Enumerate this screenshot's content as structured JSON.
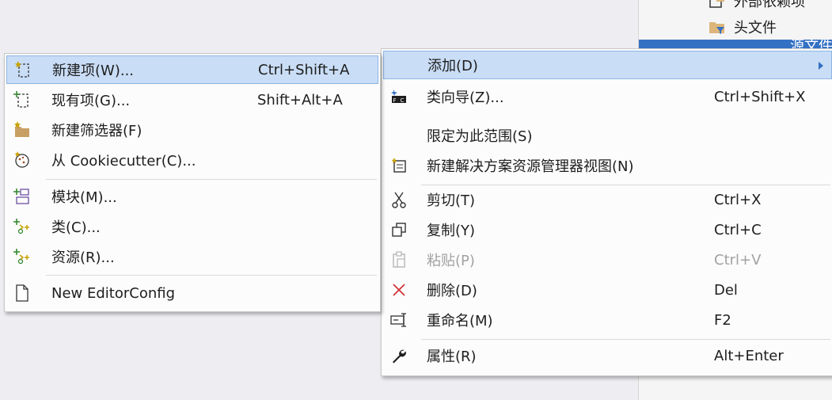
{
  "explorer": {
    "items": [
      {
        "label": "外部依赖项",
        "icon": "external-deps-icon"
      },
      {
        "label": "头文件",
        "icon": "header-files-folder-icon"
      },
      {
        "label": "源文件",
        "icon": "source-files-folder-icon"
      }
    ]
  },
  "context_menu": {
    "items": [
      {
        "label": "添加(D)",
        "shortcut": "",
        "icon": "",
        "submenu": true
      },
      {
        "label": "类向导(Z)...",
        "shortcut": "Ctrl+Shift+X",
        "icon": "class-wizard-icon"
      },
      {
        "label": "限定为此范围(S)",
        "shortcut": "",
        "icon": ""
      },
      {
        "label": "新建解决方案资源管理器视图(N)",
        "shortcut": "",
        "icon": "new-explorer-view-icon"
      },
      {
        "label": "剪切(T)",
        "shortcut": "Ctrl+X",
        "icon": "cut-icon"
      },
      {
        "label": "复制(Y)",
        "shortcut": "Ctrl+C",
        "icon": "copy-icon"
      },
      {
        "label": "粘贴(P)",
        "shortcut": "Ctrl+V",
        "icon": "paste-icon",
        "disabled": true
      },
      {
        "label": "删除(D)",
        "shortcut": "Del",
        "icon": "delete-icon"
      },
      {
        "label": "重命名(M)",
        "shortcut": "F2",
        "icon": "rename-icon"
      },
      {
        "label": "属性(R)",
        "shortcut": "Alt+Enter",
        "icon": "properties-wrench-icon"
      }
    ]
  },
  "add_submenu": {
    "items": [
      {
        "label": "新建项(W)...",
        "shortcut": "Ctrl+Shift+A",
        "icon": "new-item-icon"
      },
      {
        "label": "现有项(G)...",
        "shortcut": "Shift+Alt+A",
        "icon": "existing-item-icon"
      },
      {
        "label": "新建筛选器(F)",
        "shortcut": "",
        "icon": "new-filter-icon"
      },
      {
        "label": "从 Cookiecutter(C)...",
        "shortcut": "",
        "icon": "cookiecutter-icon"
      },
      {
        "label": "模块(M)...",
        "shortcut": "",
        "icon": "module-icon"
      },
      {
        "label": "类(C)...",
        "shortcut": "",
        "icon": "add-class-icon"
      },
      {
        "label": "资源(R)...",
        "shortcut": "",
        "icon": "add-resource-icon"
      },
      {
        "label": "New EditorConfig",
        "shortcut": "",
        "icon": "editorconfig-file-icon"
      }
    ]
  },
  "colors": {
    "highlight": "#c9ddf6",
    "accent": "#3470c4",
    "delete_red": "#d13438",
    "folder": "#dcb67a"
  }
}
